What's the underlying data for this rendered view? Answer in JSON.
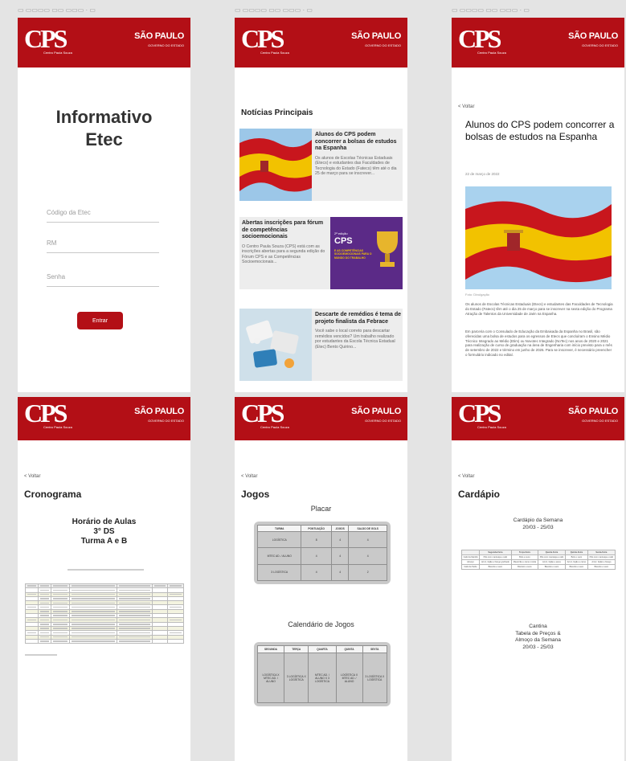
{
  "brand": {
    "logo": "CPS",
    "logo_sub": "Centro Paula Souza",
    "state_name": "SÃO PAULO",
    "state_sub": "GOVERNO DO ESTADO",
    "header_color": "#b30f16"
  },
  "back_label": "< Voltar",
  "login": {
    "title_line1": "Informativo",
    "title_line2": "Etec",
    "fields": [
      {
        "placeholder": "Código da Etec"
      },
      {
        "placeholder": "RM"
      },
      {
        "placeholder": "Senha"
      }
    ],
    "submit_label": "Entrar"
  },
  "news": {
    "heading": "Notícias Principais",
    "items": [
      {
        "title": "Alunos do CPS podem concorrer a bolsas de estudos na Espanha",
        "summary": "Os alunos de Escolas Técnicas Estaduais (Etecs) e estudantes das Faculdades de Tecnologia do Estado (Fatecs) têm até o dia 25 de março para se inscrever..."
      },
      {
        "title": "Abertas inscrições para fórum de competências socioemocionais",
        "summary": "O Centro Paula Souza (CPS) está com as inscrições abertas para a segunda edição do Fórum CPS e as Competências Socioemocionais...",
        "promo_prefix": "2ª edição",
        "promo_brand": "CPS",
        "promo_text": "E AS COMPETÊNCIAS SOCIOEMOCIONAIS PARA O MUNDO DO TRABALHO"
      },
      {
        "title": "Descarte de remédios é tema de projeto finalista da Febrace",
        "summary": "Você sabe o local correto para descartar remédios vencidos? Um trabalho realizado por estudantes da Escola Técnica Estadual (Etec) Bento Quirino..."
      }
    ]
  },
  "article": {
    "title": "Alunos do CPS podem concorrer a bolsas de estudos na Espanha",
    "date": "22 de março de 2022",
    "caption": "Foto: Divulgação",
    "paragraphs": [
      "Os alunos de Escolas Técnicas Estaduais (Etecs) e estudantes das Faculdades de Tecnologia do Estado (Fatecs) têm até o dia 25 de março para se inscrever na sexta edição do Programa Atração de Talentos da Universidade de Jaén na Espanha.",
      "Em parceria com o Consulado de Educação da Embaixada da Espanha no Brasil, são oferecidas uma bolsa de estudos para os egressos de Etecs que concluíram o Ensino Médio Técnico Integrado ao Médio (Etim) ou Novotec Integrado (NoTec) nos anos de 2020 e 2021 para realização de curso de graduação na área de Engenharia com início previsto para o mês de setembro de 2022 e término em junho de 2026. Para se inscrever, é necessário preencher o formulário indicado no edital."
    ]
  },
  "schedule": {
    "heading": "Cronograma",
    "title_lines": [
      "Horário de Aulas",
      "3° DS",
      "Turma A e B"
    ]
  },
  "games": {
    "heading": "Jogos",
    "score_title": "Placar",
    "score_headers": [
      "TURMA",
      "PONTUAÇÃO",
      "JOGOS",
      "SALDO DE GOLS"
    ],
    "score_rows": [
      [
        "LOGÍSTICA",
        "8",
        "4",
        "4"
      ],
      [
        "MTEC AD. / ALUNO",
        "4",
        "4",
        "4"
      ],
      [
        "3 LOGÍSTICA",
        "4",
        "4",
        "2"
      ]
    ],
    "calendar_title": "Calendário de Jogos",
    "calendar_headers": [
      "SEGUNDA",
      "TERÇA",
      "QUARTA",
      "QUINTA",
      "SEXTA"
    ],
    "calendar_cells": [
      "LOGÍSTICA X MTEC AD. / ALUNO",
      "3 LOGÍSTICA X LOGÍSTICA",
      "MTEC AD. / ALUNO X 3 LOGÍSTICA",
      "LOGÍSTICA X MTEC AD. / ALUNO",
      "3 LOGÍSTICA X LOGÍSTICA"
    ]
  },
  "menu": {
    "heading": "Cardápio",
    "week_title": "Cardápio da Semana",
    "week_dates": "20/03 - 25/03",
    "days": [
      "Segunda-Feira",
      "Terça-Feira",
      "Quarta-Feira",
      "Quinta-Feira",
      "Sexta-Feira"
    ],
    "rows": [
      {
        "label": "Café da Manhã",
        "cells": [
          "Pão com manteiga e café",
          "Bolo e suco",
          "Pão com manteiga e café",
          "Bolo e suco",
          "Pão com manteiga e café"
        ]
      },
      {
        "label": "Almoço",
        "cells": [
          "Arroz, feijão e frango grelhado",
          "Macarrão e carne moída",
          "Arroz, feijão e peixe",
          "Arroz, feijão e carne",
          "Arroz, feijão e frango"
        ]
      },
      {
        "label": "Café da Tarde",
        "cells": [
          "Biscoito e suco",
          "Biscoito e suco",
          "Biscoito e suco",
          "Biscoito e suco",
          "Biscoito e suco"
        ]
      }
    ],
    "canteen_lines": [
      "Cantina",
      "Tabela de Preços &",
      "Almoço da Semana",
      "20/03 - 25/03"
    ]
  }
}
